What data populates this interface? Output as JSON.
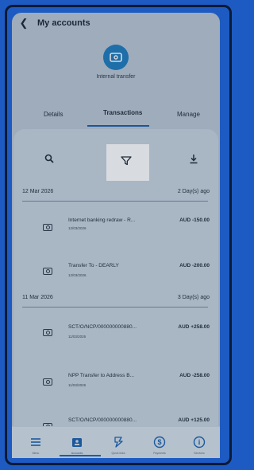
{
  "header": {
    "title": "My accounts"
  },
  "account": {
    "name": "Internal transfer"
  },
  "tabs": [
    {
      "label": "Details"
    },
    {
      "label": "Transactions",
      "active": true
    },
    {
      "label": "Manage"
    }
  ],
  "groups": [
    {
      "date": "12 Mar 2026",
      "ago": "2 Day(s) ago",
      "transactions": [
        {
          "description": "Internet banking redraw - R...",
          "date": "12/03/2026",
          "amount": "AUD -150.00"
        },
        {
          "description": "Transfer To - DEARLY",
          "date": "12/03/2026",
          "amount": "AUD -200.00"
        }
      ]
    },
    {
      "date": "11 Mar 2026",
      "ago": "3 Day(s) ago",
      "transactions": [
        {
          "description": "SCT/O/NCP/000000000880...",
          "date": "11/03/2026",
          "amount": "AUD +258.00"
        },
        {
          "description": "NPP Transfer to Address B...",
          "date": "11/03/2026",
          "amount": "AUD -258.00"
        },
        {
          "description": "SCT/O/NCP/000000000880...",
          "date": "",
          "amount": "AUD +125.00"
        }
      ]
    }
  ],
  "nav": [
    {
      "label": "Menu",
      "icon": "menu-icon"
    },
    {
      "label": "Accounts",
      "icon": "accounts-icon",
      "active": true
    },
    {
      "label": "Quick links",
      "icon": "quick-links-icon"
    },
    {
      "label": "Payments",
      "icon": "payments-icon"
    },
    {
      "label": "Services",
      "icon": "services-icon"
    }
  ],
  "colors": {
    "accent": "#1a5ea8",
    "frame": "#1d5bc2",
    "screen": "#b9c6d5"
  }
}
